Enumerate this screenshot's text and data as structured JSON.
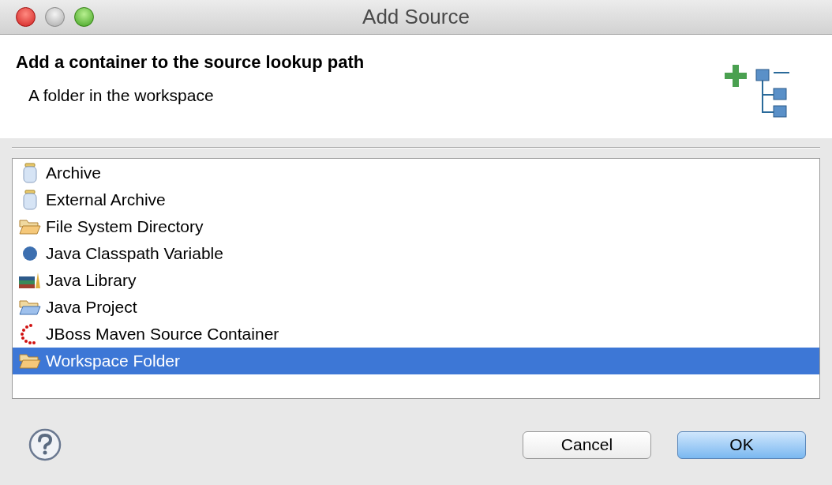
{
  "window": {
    "title": "Add Source"
  },
  "header": {
    "title": "Add a container to the source lookup path",
    "description": "A folder in the workspace"
  },
  "items": [
    {
      "label": "Archive",
      "kind": "jar",
      "selected": false
    },
    {
      "label": "External Archive",
      "kind": "jar",
      "selected": false
    },
    {
      "label": "File System Directory",
      "kind": "folder",
      "selected": false
    },
    {
      "label": "Java Classpath Variable",
      "kind": "variable",
      "selected": false
    },
    {
      "label": "Java Library",
      "kind": "library",
      "selected": false
    },
    {
      "label": "Java Project",
      "kind": "project",
      "selected": false
    },
    {
      "label": "JBoss Maven Source Container",
      "kind": "maven",
      "selected": false
    },
    {
      "label": "Workspace Folder",
      "kind": "folder",
      "selected": true
    }
  ],
  "buttons": [
    {
      "label": "Cancel",
      "default": false
    },
    {
      "label": "OK",
      "default": true
    }
  ]
}
